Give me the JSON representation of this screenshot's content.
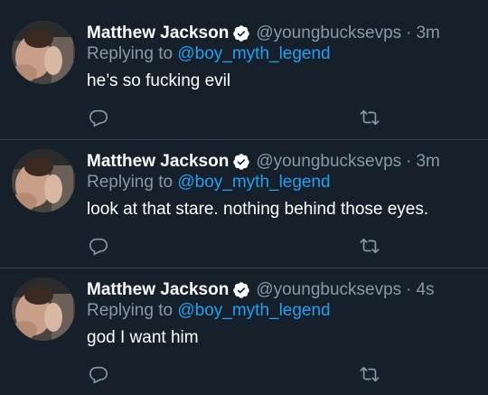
{
  "colors": {
    "background": "#15202b",
    "divider": "#38444d",
    "secondary_text": "#8899a6",
    "link": "#1da1f2",
    "verified_badge": "#ffffff"
  },
  "icons": {
    "verified": "verified-badge-icon",
    "reply": "reply-icon",
    "retweet": "retweet-icon"
  },
  "tweets": [
    {
      "author_name": "Matthew Jackson",
      "handle": "@youngbucksevps",
      "separator": "·",
      "time": "3m",
      "replying_label": "Replying to",
      "replying_to": "@boy_myth_legend",
      "text": "he’s so fucking evil"
    },
    {
      "author_name": "Matthew Jackson",
      "handle": "@youngbucksevps",
      "separator": "·",
      "time": "3m",
      "replying_label": "Replying to",
      "replying_to": "@boy_myth_legend",
      "text": "look at that stare. nothing behind those eyes."
    },
    {
      "author_name": "Matthew Jackson",
      "handle": "@youngbucksevps",
      "separator": "·",
      "time": "4s",
      "replying_label": "Replying to",
      "replying_to": "@boy_myth_legend",
      "text": "god I want him"
    }
  ]
}
